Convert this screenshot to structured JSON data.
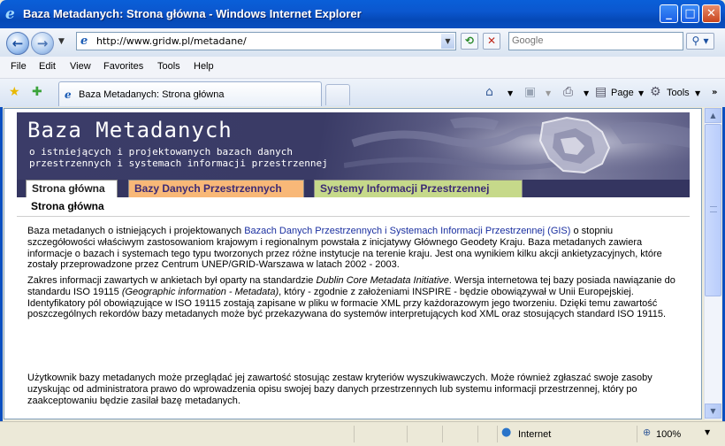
{
  "window": {
    "title": "Baza Metadanych: Strona główna - Windows Internet Explorer"
  },
  "address": {
    "url": "http://www.gridw.pl/metadane/",
    "search_placeholder": "Google"
  },
  "menu": [
    "File",
    "Edit",
    "View",
    "Favorites",
    "Tools",
    "Help"
  ],
  "browser_tab": {
    "label": "Baza Metadanych: Strona główna"
  },
  "toolbar": {
    "page_label": "Page",
    "tools_label": "Tools"
  },
  "site": {
    "banner_title": "Baza Metadanych",
    "banner_subtitle_1": "o istniejących i projektowanych bazach danych",
    "banner_subtitle_2": "przestrzennych i systemach informacji przestrzennej",
    "tabs": [
      "Strona główna",
      "Bazy Danych Przestrzennych",
      "Systemy Informacji Przestrzennej"
    ],
    "section_title": "Strona główna",
    "p1_a": "Baza metadanych o istniejących i projektowanych ",
    "p1_link": "Bazach Danych Przestrzennych i Systemach Informacji Przestrzennej (GIS)",
    "p1_b": " o stopniu szczegółowości właściwym zastosowaniom krajowym i regionalnym powstała z inicjatywy Głównego Geodety Kraju. Baza metadanych zawiera informacje o bazach i systemach tego typu tworzonych przez różne instytucje na terenie kraju. Jest ona wynikiem kilku akcji ankietyzacyjnych, które zostały przeprowadzone przez Centrum UNEP/GRID-Warszawa w latach 2002 - 2003.",
    "p2_a": "Zakres informacji zawartych w ankietach był oparty na standardzie ",
    "p2_em1": "Dublin Core Metadata Initiative",
    "p2_b": ". Wersja internetowa tej bazy posiada nawiązanie do standardu ISO 19115 ",
    "p2_em2": "(Geographic information - Metadata)",
    "p2_c": ", który - zgodnie z założeniami INSPIRE - będzie obowiązywał w Unii Europejskiej. Identyfikatory pól obowiązujące w ISO 19115 zostają zapisane w pliku w formacie XML przy każdorazowym jego tworzeniu. Dzięki temu zawartość poszczególnych rekordów bazy metadanych może być przekazywana do systemów interpretujących kod XML oraz stosujących standard ISO 19115.",
    "p3": "Użytkownik bazy metadanych może przeglądać jej zawartość stosując zestaw kryteriów wyszukiwawczych. Może również zgłaszać swoje zasoby uzyskując od administratora prawo do wprowadzenia opisu swojej bazy danych przestrzennych lub systemu informacji przestrzennej, który po zaakceptowaniu będzie zasilał bazę metadanych."
  },
  "status": {
    "zone": "Internet",
    "zoom": "100%"
  },
  "colors": {
    "titlebar": "#0549b7",
    "banner": "#3b3c68",
    "tab_orange": "#f8b878",
    "tab_green": "#c6d98a",
    "link": "#1a2fa0"
  }
}
